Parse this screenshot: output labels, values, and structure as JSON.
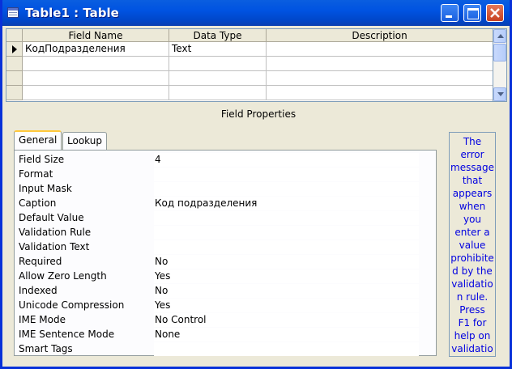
{
  "window": {
    "title": "Table1 : Table"
  },
  "grid": {
    "columns": [
      "Field Name",
      "Data Type",
      "Description"
    ],
    "rows": [
      {
        "field_name": "КодПодразделения",
        "data_type": "Text",
        "description": ""
      }
    ]
  },
  "field_properties": {
    "title": "Field Properties",
    "tabs": [
      "General",
      "Lookup"
    ],
    "active_tab": "General",
    "properties": [
      {
        "label": "Field Size",
        "value": "4"
      },
      {
        "label": "Format",
        "value": ""
      },
      {
        "label": "Input Mask",
        "value": ""
      },
      {
        "label": "Caption",
        "value": "Код подразделения"
      },
      {
        "label": "Default Value",
        "value": ""
      },
      {
        "label": "Validation Rule",
        "value": ""
      },
      {
        "label": "Validation Text",
        "value": ""
      },
      {
        "label": "Required",
        "value": "No"
      },
      {
        "label": "Allow Zero Length",
        "value": "Yes"
      },
      {
        "label": "Indexed",
        "value": "No"
      },
      {
        "label": "Unicode Compression",
        "value": "Yes"
      },
      {
        "label": "IME Mode",
        "value": "No Control"
      },
      {
        "label": "IME Sentence Mode",
        "value": "None"
      },
      {
        "label": "Smart Tags",
        "value": ""
      }
    ]
  },
  "help": {
    "lines": [
      "The",
      "error",
      "message",
      "that",
      "appears",
      "when",
      "you",
      "enter a",
      "value",
      "prohibite",
      "d by the",
      "validatio",
      "n rule.",
      "Press",
      "F1 for",
      "help on",
      "validatio"
    ],
    "color": "#0000e0"
  },
  "colors": {
    "titlebar": "#0053e1",
    "window_bg": "#ece9d8",
    "help_text": "#0000e0"
  }
}
